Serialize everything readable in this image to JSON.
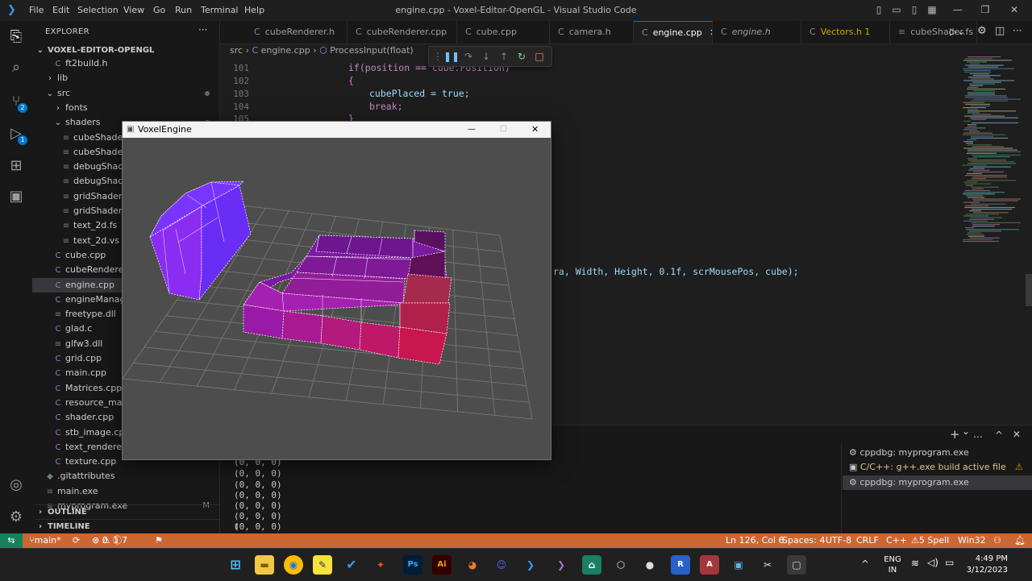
{
  "app": {
    "window_title": "engine.cpp - Voxel-Editor-OpenGL - Visual Studio Code",
    "menu": [
      "File",
      "Edit",
      "Selection",
      "View",
      "Go",
      "Run",
      "Terminal",
      "Help"
    ]
  },
  "sidebar": {
    "header": "EXPLORER",
    "root": "VOXEL-EDITOR-OPENGL",
    "items": [
      {
        "label": "ft2build.h",
        "indent": 2,
        "kind": "file",
        "icon": "h"
      },
      {
        "label": "lib",
        "indent": 1,
        "kind": "folder",
        "open": false
      },
      {
        "label": "src",
        "indent": 1,
        "kind": "folder",
        "open": true,
        "dot": true
      },
      {
        "label": "fonts",
        "indent": 2,
        "kind": "folder",
        "open": false
      },
      {
        "label": "shaders",
        "indent": 2,
        "kind": "folder",
        "open": true,
        "dot": true
      },
      {
        "label": "cubeShader.fs",
        "indent": 3,
        "kind": "file",
        "icon": "txt"
      },
      {
        "label": "cubeShader.vs",
        "indent": 3,
        "kind": "file",
        "icon": "txt"
      },
      {
        "label": "debugShader.fs",
        "indent": 3,
        "kind": "file",
        "icon": "txt"
      },
      {
        "label": "debugShader.vs",
        "indent": 3,
        "kind": "file",
        "icon": "txt"
      },
      {
        "label": "gridShader.fs",
        "indent": 3,
        "kind": "file",
        "icon": "txt"
      },
      {
        "label": "gridShader.vs",
        "indent": 3,
        "kind": "file",
        "icon": "txt"
      },
      {
        "label": "text_2d.fs",
        "indent": 3,
        "kind": "file",
        "icon": "txt"
      },
      {
        "label": "text_2d.vs",
        "indent": 3,
        "kind": "file",
        "icon": "txt"
      },
      {
        "label": "cube.cpp",
        "indent": 2,
        "kind": "file",
        "icon": "cpp"
      },
      {
        "label": "cubeRenderer.cpp",
        "indent": 2,
        "kind": "file",
        "icon": "cpp"
      },
      {
        "label": "engine.cpp",
        "indent": 2,
        "kind": "file",
        "icon": "cpp",
        "selected": true
      },
      {
        "label": "engineManager.cpp",
        "indent": 2,
        "kind": "file",
        "icon": "cpp"
      },
      {
        "label": "freetype.dll",
        "indent": 2,
        "kind": "file",
        "icon": "dll"
      },
      {
        "label": "glad.c",
        "indent": 2,
        "kind": "file",
        "icon": "c"
      },
      {
        "label": "glfw3.dll",
        "indent": 2,
        "kind": "file",
        "icon": "dll"
      },
      {
        "label": "grid.cpp",
        "indent": 2,
        "kind": "file",
        "icon": "cpp"
      },
      {
        "label": "main.cpp",
        "indent": 2,
        "kind": "file",
        "icon": "cpp"
      },
      {
        "label": "Matrices.cpp",
        "indent": 2,
        "kind": "file",
        "icon": "cpp"
      },
      {
        "label": "resource_manager.cpp",
        "indent": 2,
        "kind": "file",
        "icon": "cpp"
      },
      {
        "label": "shader.cpp",
        "indent": 2,
        "kind": "file",
        "icon": "cpp"
      },
      {
        "label": "stb_image.cpp",
        "indent": 2,
        "kind": "file",
        "icon": "cpp"
      },
      {
        "label": "text_renderer.cpp",
        "indent": 2,
        "kind": "file",
        "icon": "cpp"
      },
      {
        "label": "texture.cpp",
        "indent": 2,
        "kind": "file",
        "icon": "cpp"
      },
      {
        "label": ".gitattributes",
        "indent": 1,
        "kind": "file",
        "icon": "git"
      },
      {
        "label": "main.exe",
        "indent": 1,
        "kind": "file",
        "icon": "exe"
      },
      {
        "label": "myprogram.exe",
        "indent": 1,
        "kind": "file",
        "icon": "exe",
        "mod": "M"
      }
    ],
    "outline": "OUTLINE",
    "timeline": "TIMELINE"
  },
  "tabs": [
    {
      "label": "cubeRenderer.h",
      "icon": "C"
    },
    {
      "label": "cubeRenderer.cpp",
      "icon": "C"
    },
    {
      "label": "cube.cpp",
      "icon": "C"
    },
    {
      "label": "camera.h",
      "icon": "C"
    },
    {
      "label": "engine.cpp",
      "icon": "C",
      "active": true,
      "close": "✕"
    },
    {
      "label": "engine.h",
      "icon": "C",
      "italic": true
    },
    {
      "label": "Vectors.h 1",
      "icon": "C",
      "warn": true
    },
    {
      "label": "cubeShader.fs",
      "icon": "≡"
    }
  ],
  "breadcrumb": [
    "src",
    "engine.cpp",
    "ProcessInput(float)"
  ],
  "editor": {
    "line_numbers": [
      "101",
      "102",
      "103",
      "104",
      "105"
    ],
    "lines": [
      "if(position == cube.Position)",
      "{",
      "cubePlaced = true;",
      "break;",
      "}"
    ],
    "right_fragment": "ra, Width, Height, 0.1f, scrMousePos, cube);"
  },
  "terminal": {
    "lines": [
      "(0, 0, 0)",
      "(0, 0, 0)",
      "(0, 0, 0)",
      "(0, 0, 0)",
      "(0, 0, 0)",
      "(0, 0, 0)",
      "(0, 0, 0)"
    ],
    "cursor": "▯",
    "list": [
      {
        "label": "cppdbg: myprogram.exe",
        "icon": "gear-icon"
      },
      {
        "label": "C/C++: g++.exe build active file",
        "icon": "terminal-icon",
        "warn": "⚠"
      },
      {
        "label": "cppdbg: myprogram.exe",
        "icon": "gear-icon",
        "selected": true
      }
    ],
    "actions": [
      "+",
      "⌄",
      "…",
      "^",
      "✕"
    ]
  },
  "status": {
    "branch": "main*",
    "errors": "0",
    "warnings": "1",
    "info": "7",
    "position": "Ln 126, Col 6",
    "spaces": "Spaces: 4",
    "encoding": "UTF-8",
    "eol": "CRLF",
    "language": "C++",
    "spell": "5 Spell",
    "platform": "Win32",
    "color": "#cc6633"
  },
  "voxel": {
    "title": "VoxelEngine",
    "minimize": "—",
    "maximize": "☐",
    "close": "✕"
  },
  "taskbar": {
    "lang1": "ENG",
    "lang2": "IN",
    "time": "4:49 PM",
    "date": "3/12/2023"
  }
}
